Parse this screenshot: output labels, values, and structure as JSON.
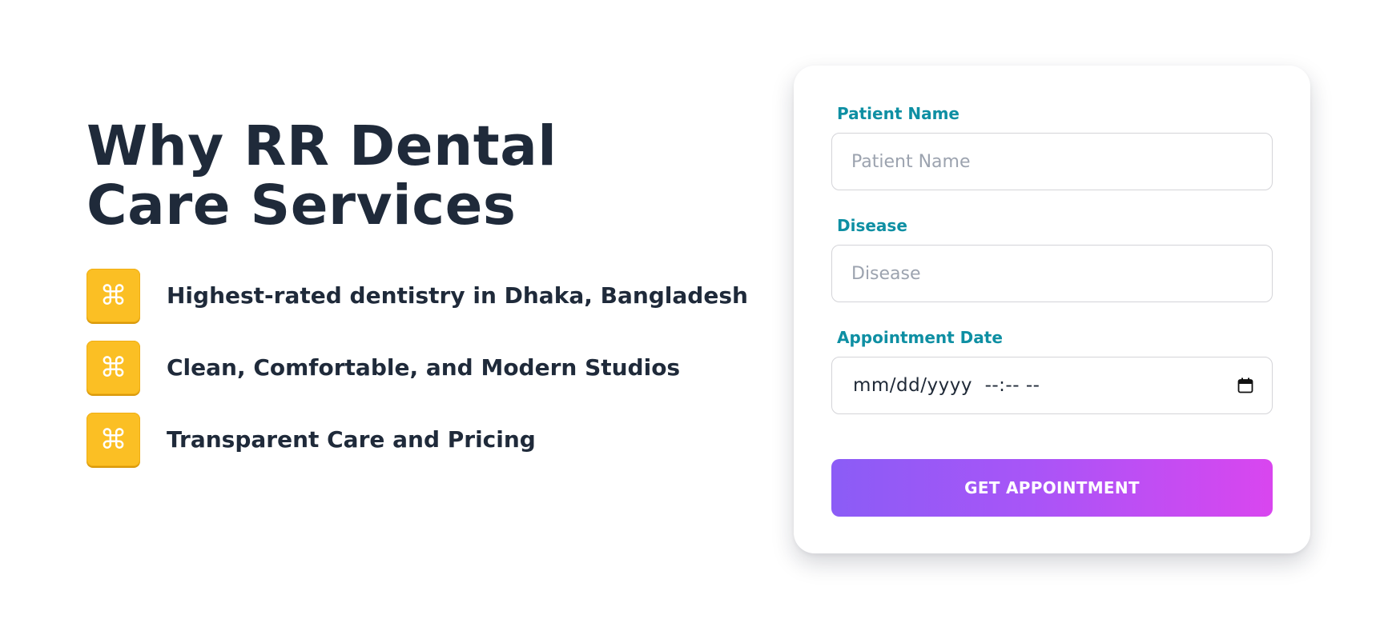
{
  "hero": {
    "title": "Why RR Dental Care Services"
  },
  "features": [
    {
      "icon": "command-icon",
      "glyph": "⌘",
      "text": "Highest-rated dentistry in Dhaka, Bangladesh"
    },
    {
      "icon": "command-icon",
      "glyph": "⌘",
      "text": "Clean, Comfortable, and Modern Studios"
    },
    {
      "icon": "command-icon",
      "glyph": "⌘",
      "text": "Transparent Care and Pricing"
    }
  ],
  "form": {
    "patient_name": {
      "label": "Patient Name",
      "placeholder": "Patient Name",
      "value": ""
    },
    "disease": {
      "label": "Disease",
      "placeholder": "Disease",
      "value": ""
    },
    "appointment_date": {
      "label": "Appointment Date",
      "display": "mm/dd/yyyy  --:-- --",
      "icon": "calendar-icon"
    },
    "submit_label": "GET APPOINTMENT"
  },
  "colors": {
    "heading": "#1f2a3a",
    "label_accent": "#0e8fa3",
    "feature_icon_bg": "#fbbf24",
    "button_gradient_start": "#8b5cf6",
    "button_gradient_end": "#d946ef"
  }
}
